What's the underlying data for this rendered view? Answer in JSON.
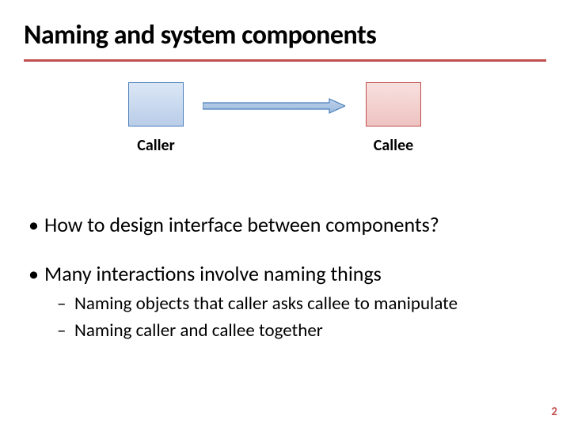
{
  "title": "Naming and system components",
  "diagram": {
    "caller_label": "Caller",
    "callee_label": "Callee"
  },
  "bullets": {
    "b1": "How to design interface between components?",
    "b2": "Many interactions involve naming things",
    "b2_sub1": "Naming objects that caller asks callee to manipulate",
    "b2_sub2": "Naming caller and callee together"
  },
  "page_number": "2",
  "colors": {
    "accent": "#c0504d",
    "caller": "#4a7ebb",
    "callee": "#c0504d"
  }
}
